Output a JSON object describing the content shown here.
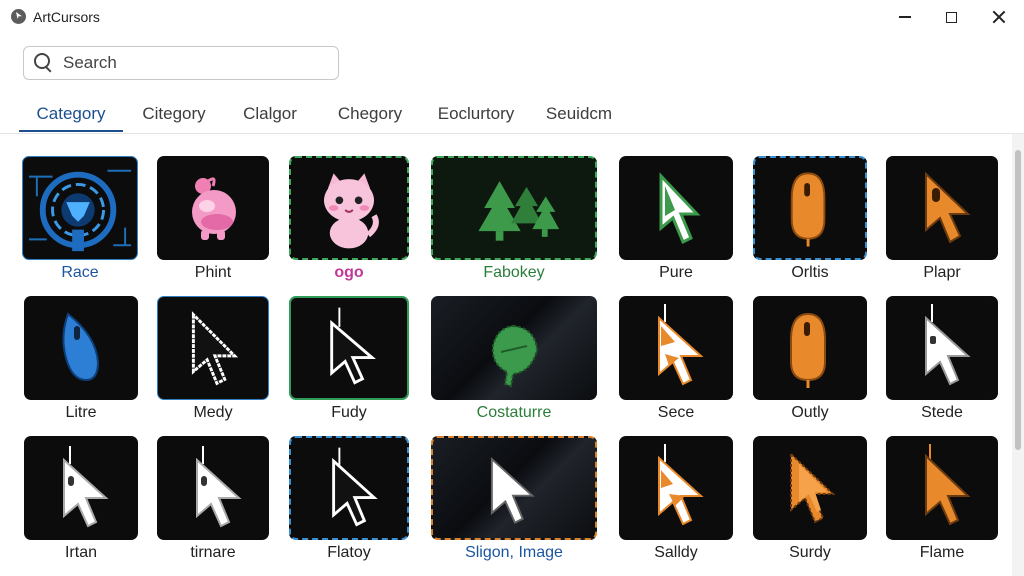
{
  "window": {
    "title": "ArtCursors",
    "controls": {
      "minimize_icon": "minimize-icon",
      "maximize_icon": "maximize-icon",
      "close_icon": "close-icon"
    }
  },
  "search": {
    "placeholder": "Search",
    "value": ""
  },
  "tabs": [
    {
      "label": "Category",
      "active": true
    },
    {
      "label": "Citegory"
    },
    {
      "label": "Clalgor"
    },
    {
      "label": "Chegory"
    },
    {
      "label": "Eoclurtory"
    },
    {
      "label": "Seuidcm"
    }
  ],
  "grid": {
    "rows": [
      [
        {
          "label": "Race",
          "icon": "cyber-shield-icon",
          "label_color": "#1b57a0"
        },
        {
          "label": "Phint",
          "icon": "pink-mascot-icon"
        },
        {
          "label": "ogo",
          "icon": "pink-cat-icon"
        },
        {
          "label": "Fabokey",
          "icon": "pine-trees-icon",
          "label_color": "#2b7d3a"
        },
        {
          "label": "Pure",
          "icon": "green-arrow-cursor-icon"
        },
        {
          "label": "Orltis",
          "icon": "orange-mouse-icon"
        },
        {
          "label": "Plapr",
          "icon": "orange-mouse-arrow-icon"
        }
      ],
      [
        {
          "label": "Litre",
          "icon": "blue-mouse-icon"
        },
        {
          "label": "Medy",
          "icon": "white-arrow-cursor-icon"
        },
        {
          "label": "Fudy",
          "icon": "white-arrow-cursor-icon"
        },
        {
          "label": "Costaturre",
          "icon": "green-leaf-icon",
          "label_color": "#2b7d3a"
        },
        {
          "label": "Sece",
          "icon": "orange-white-arrow-icon"
        },
        {
          "label": "Outly",
          "icon": "orange-mouse-icon"
        },
        {
          "label": "Stede",
          "icon": "white-arrow-cursor-icon"
        }
      ],
      [
        {
          "label": "Irtan",
          "icon": "white-arrow-cursor-icon"
        },
        {
          "label": "tirnare",
          "icon": "white-arrow-cursor-icon"
        },
        {
          "label": "Flatoy",
          "icon": "white-arrow-cursor-icon"
        },
        {
          "label": "Sligon, Image",
          "icon": "white-arrow-cursor-icon",
          "label_color": "#1b57a0"
        },
        {
          "label": "Salldy",
          "icon": "orange-white-arrow-icon"
        },
        {
          "label": "Surdy",
          "icon": "orange-arrow-cursor-icon"
        },
        {
          "label": "Flame",
          "icon": "orange-arrow-cursor-icon"
        }
      ]
    ]
  },
  "colors": {
    "accent": "#1b4f8f",
    "green_label": "#2b7d3a",
    "blue_label": "#1b57a0",
    "cursor_orange": "#e8892c",
    "cursor_green": "#3c9a4c",
    "cursor_blue": "#2d7fd6"
  }
}
